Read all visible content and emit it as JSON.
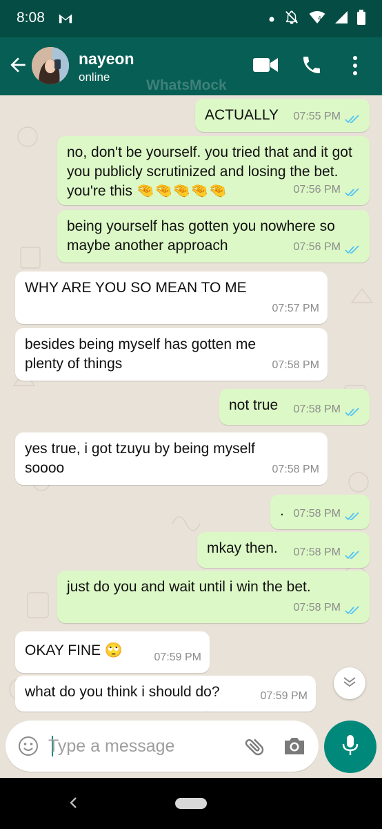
{
  "status_bar": {
    "time": "8:08",
    "left_icon": "gmail-icon",
    "right_icons": [
      "dot-icon",
      "mute-icon",
      "wifi-icon",
      "signal-icon",
      "battery-icon"
    ],
    "background": "#054d44"
  },
  "header": {
    "contact_name": "nayeon",
    "status": "online",
    "watermark": "WhatsMock",
    "background": "#075e54",
    "actions": [
      "video-call-icon",
      "call-icon",
      "menu-icon"
    ]
  },
  "messages": [
    {
      "direction": "out",
      "text": "ACTUALLY",
      "time": "07:55 PM",
      "read": true
    },
    {
      "direction": "out",
      "text": "no, don't be yourself. you tried that and it got you publicly scrutinized and losing the bet. you're this 🤏🤏🤏🤏🤏",
      "time": "07:56 PM",
      "read": true
    },
    {
      "direction": "out",
      "text": "being yourself has gotten you nowhere so maybe another approach",
      "time": "07:56 PM",
      "read": true
    },
    {
      "direction": "in",
      "text": "WHY ARE YOU SO MEAN TO ME",
      "time": "07:57 PM"
    },
    {
      "direction": "in",
      "text": "besides being myself has gotten me plenty of things",
      "time": "07:58 PM"
    },
    {
      "direction": "out",
      "text": "not true",
      "time": "07:58 PM",
      "read": true
    },
    {
      "direction": "in",
      "text": "yes true, i got tzuyu by being myself soooo",
      "time": "07:58 PM"
    },
    {
      "direction": "out",
      "text": ".",
      "time": "07:58 PM",
      "read": true
    },
    {
      "direction": "out",
      "text": "mkay then.",
      "time": "07:58 PM",
      "read": true
    },
    {
      "direction": "out",
      "text": "just do you and wait until i win the bet.",
      "time": "07:58 PM",
      "read": true
    },
    {
      "direction": "in",
      "text": "OKAY FINE 🙄",
      "time": "07:59 PM"
    },
    {
      "direction": "in",
      "text": "what do you think i should do?",
      "time": "07:59 PM"
    }
  ],
  "composer": {
    "placeholder": "Type a message",
    "value": ""
  },
  "colors": {
    "outgoing_bubble": "#dcf8c6",
    "incoming_bubble": "#ffffff",
    "chat_background": "#e9e2d8",
    "read_tick": "#4fc3f7",
    "accent": "#00897b"
  }
}
